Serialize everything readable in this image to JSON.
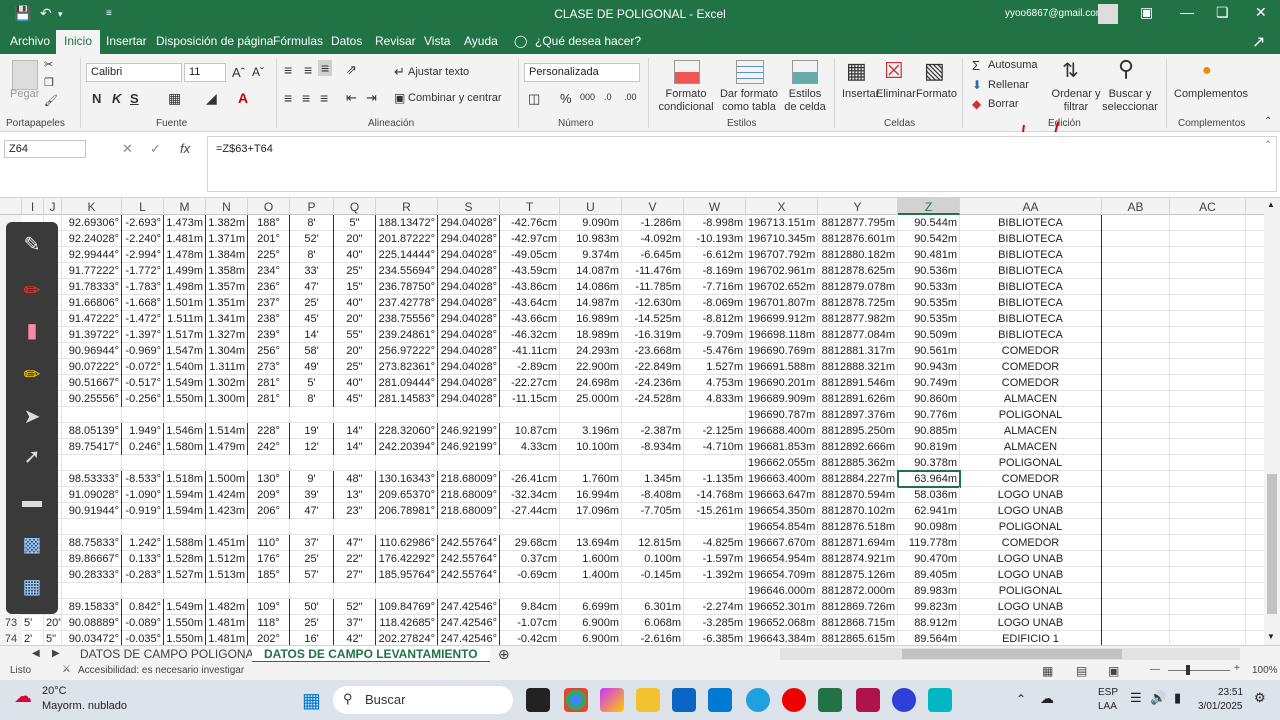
{
  "window": {
    "title": "CLASE DE POLIGONAL - Excel",
    "account": "yyoo6867@gmail.com"
  },
  "menu": [
    "Archivo",
    "Inicio",
    "Insertar",
    "Disposición de página",
    "Fórmulas",
    "Datos",
    "Revisar",
    "Vista",
    "Ayuda",
    "¿Qué desea hacer?"
  ],
  "ribbon": {
    "paste": "Pegar",
    "clipboard": "Portapapeles",
    "font_name": "Calibri",
    "font_size": "11",
    "font_group": "Fuente",
    "wrap": "Ajustar texto",
    "merge": "Combinar y centrar",
    "align_group": "Alineación",
    "number_format": "Personalizada",
    "number_group": "Número",
    "cond_format": "Formato condicional",
    "table_format": "Dar formato como tabla",
    "cell_styles": "Estilos de celda",
    "styles_group": "Estilos",
    "insert": "Insertar",
    "delete": "Eliminar",
    "format": "Formato",
    "cells_group": "Celdas",
    "autosum": "Autosuma",
    "fill": "Rellenar",
    "clear": "Borrar",
    "sort": "Ordenar y filtrar",
    "find": "Buscar y seleccionar",
    "edit_group": "Edición",
    "complements": "Complementos",
    "complements_group": "Complementos"
  },
  "formula_bar": {
    "namebox": "Z64",
    "formula": "=Z$63+T64"
  },
  "columns": [
    "I",
    "J",
    "K",
    "L",
    "M",
    "N",
    "O",
    "P",
    "Q",
    "R",
    "S",
    "T",
    "U",
    "V",
    "W",
    "X",
    "Y",
    "Z",
    "AA",
    "AB",
    "AC"
  ],
  "rows": [
    {
      "n": "",
      "k": "92.69306°",
      "l": "-2.693°",
      "m": "1.473m",
      "nn": "1.382m",
      "o": "188°",
      "p": "8'",
      "q": "5\"",
      "r": "188.13472°",
      "s": "294.04028°",
      "t": "-42.76cm",
      "u": "9.090m",
      "v": "-1.286m",
      "w": "-8.998m",
      "x": "196713.151m",
      "y": "8812877.795m",
      "z": "90.544m",
      "aa": "BIBLIOTECA"
    },
    {
      "n": "",
      "k": "92.24028°",
      "l": "-2.240°",
      "m": "1.481m",
      "nn": "1.371m",
      "o": "201°",
      "p": "52'",
      "q": "20\"",
      "r": "201.87222°",
      "s": "294.04028°",
      "t": "-42.97cm",
      "u": "10.983m",
      "v": "-4.092m",
      "w": "-10.193m",
      "x": "196710.345m",
      "y": "8812876.601m",
      "z": "90.542m",
      "aa": "BIBLIOTECA"
    },
    {
      "n": "",
      "k": "92.99444°",
      "l": "-2.994°",
      "m": "1.478m",
      "nn": "1.384m",
      "o": "225°",
      "p": "8'",
      "q": "40\"",
      "r": "225.14444°",
      "s": "294.04028°",
      "t": "-49.05cm",
      "u": "9.374m",
      "v": "-6.645m",
      "w": "-6.612m",
      "x": "196707.792m",
      "y": "8812880.182m",
      "z": "90.481m",
      "aa": "BIBLIOTECA"
    },
    {
      "n": "",
      "k": "91.77222°",
      "l": "-1.772°",
      "m": "1.499m",
      "nn": "1.358m",
      "o": "234°",
      "p": "33'",
      "q": "25\"",
      "r": "234.55694°",
      "s": "294.04028°",
      "t": "-43.59cm",
      "u": "14.087m",
      "v": "-11.476m",
      "w": "-8.169m",
      "x": "196702.961m",
      "y": "8812878.625m",
      "z": "90.536m",
      "aa": "BIBLIOTECA"
    },
    {
      "n": "",
      "k": "91.78333°",
      "l": "-1.783°",
      "m": "1.498m",
      "nn": "1.357m",
      "o": "236°",
      "p": "47'",
      "q": "15\"",
      "r": "236.78750°",
      "s": "294.04028°",
      "t": "-43.86cm",
      "u": "14.086m",
      "v": "-11.785m",
      "w": "-7.716m",
      "x": "196702.652m",
      "y": "8812879.078m",
      "z": "90.533m",
      "aa": "BIBLIOTECA"
    },
    {
      "n": "",
      "k": "91.66806°",
      "l": "-1.668°",
      "m": "1.501m",
      "nn": "1.351m",
      "o": "237°",
      "p": "25'",
      "q": "40\"",
      "r": "237.42778°",
      "s": "294.04028°",
      "t": "-43.64cm",
      "u": "14.987m",
      "v": "-12.630m",
      "w": "-8.069m",
      "x": "196701.807m",
      "y": "8812878.725m",
      "z": "90.535m",
      "aa": "BIBLIOTECA"
    },
    {
      "n": "",
      "k": "91.47222°",
      "l": "-1.472°",
      "m": "1.511m",
      "nn": "1.341m",
      "o": "238°",
      "p": "45'",
      "q": "20\"",
      "r": "238.75556°",
      "s": "294.04028°",
      "t": "-43.66cm",
      "u": "16.989m",
      "v": "-14.525m",
      "w": "-8.812m",
      "x": "196699.912m",
      "y": "8812877.982m",
      "z": "90.535m",
      "aa": "BIBLIOTECA"
    },
    {
      "n": "",
      "k": "91.39722°",
      "l": "-1.397°",
      "m": "1.517m",
      "nn": "1.327m",
      "o": "239°",
      "p": "14'",
      "q": "55\"",
      "r": "239.24861°",
      "s": "294.04028°",
      "t": "-46.32cm",
      "u": "18.989m",
      "v": "-16.319m",
      "w": "-9.709m",
      "x": "196698.118m",
      "y": "8812877.084m",
      "z": "90.509m",
      "aa": "BIBLIOTECA"
    },
    {
      "n": "",
      "k": "90.96944°",
      "l": "-0.969°",
      "m": "1.547m",
      "nn": "1.304m",
      "o": "256°",
      "p": "58'",
      "q": "20\"",
      "r": "256.97222°",
      "s": "294.04028°",
      "t": "-41.11cm",
      "u": "24.293m",
      "v": "-23.668m",
      "w": "-5.476m",
      "x": "196690.769m",
      "y": "8812881.317m",
      "z": "90.561m",
      "aa": "COMEDOR"
    },
    {
      "n": "",
      "k": "90.07222°",
      "l": "-0.072°",
      "m": "1.540m",
      "nn": "1.311m",
      "o": "273°",
      "p": "49'",
      "q": "25\"",
      "r": "273.82361°",
      "s": "294.04028°",
      "t": "-2.89cm",
      "u": "22.900m",
      "v": "-22.849m",
      "w": "1.527m",
      "x": "196691.588m",
      "y": "8812888.321m",
      "z": "90.943m",
      "aa": "COMEDOR"
    },
    {
      "n": "",
      "k": "90.51667°",
      "l": "-0.517°",
      "m": "1.549m",
      "nn": "1.302m",
      "o": "281°",
      "p": "5'",
      "q": "40\"",
      "r": "281.09444°",
      "s": "294.04028°",
      "t": "-22.27cm",
      "u": "24.698m",
      "v": "-24.236m",
      "w": "4.753m",
      "x": "196690.201m",
      "y": "8812891.546m",
      "z": "90.749m",
      "aa": "COMEDOR"
    },
    {
      "n": "",
      "k": "90.25556°",
      "l": "-0.256°",
      "m": "1.550m",
      "nn": "1.300m",
      "o": "281°",
      "p": "8'",
      "q": "45\"",
      "r": "281.14583°",
      "s": "294.04028°",
      "t": "-11.15cm",
      "u": "25.000m",
      "v": "-24.528m",
      "w": "4.833m",
      "x": "196689.909m",
      "y": "8812891.626m",
      "z": "90.860m",
      "aa": "ALMACEN"
    },
    {
      "n": "",
      "k": "",
      "l": "",
      "m": "",
      "nn": "",
      "o": "",
      "p": "",
      "q": "",
      "r": "",
      "s": "",
      "t": "",
      "u": "",
      "v": "",
      "w": "",
      "x": "196690.787m",
      "y": "8812897.376m",
      "z": "90.776m",
      "aa": "POLIGONAL"
    },
    {
      "n": "",
      "k": "88.05139°",
      "l": "1.949°",
      "m": "1.546m",
      "nn": "1.514m",
      "o": "228°",
      "p": "19'",
      "q": "14\"",
      "r": "228.32060°",
      "s": "246.92199°",
      "t": "10.87cm",
      "u": "3.196m",
      "v": "-2.387m",
      "w": "-2.125m",
      "x": "196688.400m",
      "y": "8812895.250m",
      "z": "90.885m",
      "aa": "ALMACEN"
    },
    {
      "n": "",
      "k": "89.75417°",
      "l": "0.246°",
      "m": "1.580m",
      "nn": "1.479m",
      "o": "242°",
      "p": "12'",
      "q": "14\"",
      "r": "242.20394°",
      "s": "246.92199°",
      "t": "4.33cm",
      "u": "10.100m",
      "v": "-8.934m",
      "w": "-4.710m",
      "x": "196681.853m",
      "y": "8812892.666m",
      "z": "90.819m",
      "aa": "ALMACEN"
    },
    {
      "n": "",
      "k": "",
      "l": "",
      "m": "",
      "nn": "",
      "o": "",
      "p": "",
      "q": "",
      "r": "",
      "s": "",
      "t": "",
      "u": "",
      "v": "",
      "w": "",
      "x": "196662.055m",
      "y": "8812885.362m",
      "z": "90.378m",
      "aa": "POLIGONAL"
    },
    {
      "n": "",
      "k": "98.53333°",
      "l": "-8.533°",
      "m": "1.518m",
      "nn": "1.500m",
      "o": "130°",
      "p": "9'",
      "q": "48\"",
      "r": "130.16343°",
      "s": "218.68009°",
      "t": "-26.41cm",
      "u": "1.760m",
      "v": "1.345m",
      "w": "-1.135m",
      "x": "196663.400m",
      "y": "8812884.227m",
      "z": "63.964m",
      "aa": "COMEDOR"
    },
    {
      "n": "",
      "k": "91.09028°",
      "l": "-1.090°",
      "m": "1.594m",
      "nn": "1.424m",
      "o": "209°",
      "p": "39'",
      "q": "13\"",
      "r": "209.65370°",
      "s": "218.68009°",
      "t": "-32.34cm",
      "u": "16.994m",
      "v": "-8.408m",
      "w": "-14.768m",
      "x": "196663.647m",
      "y": "8812870.594m",
      "z": "58.036m",
      "aa": "LOGO UNAB"
    },
    {
      "n": "",
      "k": "90.91944°",
      "l": "-0.919°",
      "m": "1.594m",
      "nn": "1.423m",
      "o": "206°",
      "p": "47'",
      "q": "23\"",
      "r": "206.78981°",
      "s": "218.68009°",
      "t": "-27.44cm",
      "u": "17.096m",
      "v": "-7.705m",
      "w": "-15.261m",
      "x": "196654.350m",
      "y": "8812870.102m",
      "z": "62.941m",
      "aa": "LOGO UNAB"
    },
    {
      "n": "",
      "k": "",
      "l": "",
      "m": "",
      "nn": "",
      "o": "",
      "p": "",
      "q": "",
      "r": "",
      "s": "",
      "t": "",
      "u": "",
      "v": "",
      "w": "",
      "x": "196654.854m",
      "y": "8812876.518m",
      "z": "90.098m",
      "aa": "POLIGONAL"
    },
    {
      "n": "",
      "k": "88.75833°",
      "l": "1.242°",
      "m": "1.588m",
      "nn": "1.451m",
      "o": "110°",
      "p": "37'",
      "q": "47\"",
      "r": "110.62986°",
      "s": "242.55764°",
      "t": "29.68cm",
      "u": "13.694m",
      "v": "12.815m",
      "w": "-4.825m",
      "x": "196667.670m",
      "y": "8812871.694m",
      "z": "119.778m",
      "aa": "COMEDOR"
    },
    {
      "n": "",
      "k": "89.86667°",
      "l": "0.133°",
      "m": "1.528m",
      "nn": "1.512m",
      "o": "176°",
      "p": "25'",
      "q": "22\"",
      "r": "176.42292°",
      "s": "242.55764°",
      "t": "0.37cm",
      "u": "1.600m",
      "v": "0.100m",
      "w": "-1.597m",
      "x": "196654.954m",
      "y": "8812874.921m",
      "z": "90.470m",
      "aa": "LOGO UNAB"
    },
    {
      "n": "",
      "k": "90.28333°",
      "l": "-0.283°",
      "m": "1.527m",
      "nn": "1.513m",
      "o": "185°",
      "p": "57'",
      "q": "27\"",
      "r": "185.95764°",
      "s": "242.55764°",
      "t": "-0.69cm",
      "u": "1.400m",
      "v": "-0.145m",
      "w": "-1.392m",
      "x": "196654.709m",
      "y": "8812875.126m",
      "z": "89.405m",
      "aa": "LOGO UNAB"
    },
    {
      "n": "",
      "k": "",
      "l": "",
      "m": "",
      "nn": "",
      "o": "",
      "p": "",
      "q": "",
      "r": "",
      "s": "",
      "t": "",
      "u": "",
      "v": "",
      "w": "",
      "x": "196646.000m",
      "y": "8812872.000m",
      "z": "89.983m",
      "aa": "POLIGONAL"
    },
    {
      "n": "",
      "k": "89.15833°",
      "l": "0.842°",
      "m": "1.549m",
      "nn": "1.482m",
      "o": "109°",
      "p": "50'",
      "q": "52\"",
      "r": "109.84769°",
      "s": "247.42546°",
      "t": "9.84cm",
      "u": "6.699m",
      "v": "6.301m",
      "w": "-2.274m",
      "x": "196652.301m",
      "y": "8812869.726m",
      "z": "99.823m",
      "aa": "LOGO UNAB"
    },
    {
      "n": "73",
      "k": "90.08889°",
      "l": "-0.089°",
      "m": "1.550m",
      "nn": "1.481m",
      "o": "118°",
      "p": "25'",
      "q": "37\"",
      "r": "118.42685°",
      "s": "247.42546°",
      "t": "-1.07cm",
      "u": "6.900m",
      "v": "6.068m",
      "w": "-3.285m",
      "x": "196652.068m",
      "y": "8812868.715m",
      "z": "88.912m",
      "aa": "LOGO UNAB",
      "i": "5'",
      "j": "20\""
    },
    {
      "n": "74",
      "k": "90.03472°",
      "l": "-0.035°",
      "m": "1.550m",
      "nn": "1.481m",
      "o": "202°",
      "p": "16'",
      "q": "42\"",
      "r": "202.27824°",
      "s": "247.42546°",
      "t": "-0.42cm",
      "u": "6.900m",
      "v": "-2.616m",
      "w": "-6.385m",
      "x": "196643.384m",
      "y": "8812865.615m",
      "z": "89.564m",
      "aa": "EDIFICIO 1",
      "i": "2'",
      "j": "5\""
    }
  ],
  "sheets": [
    "DATOS DE CAMPO POLIGONAL",
    "DATOS DE CAMPO LEVANTAMIENTO"
  ],
  "status": {
    "ready": "Listo",
    "accessibility": "Accesibilidad: es necesario investigar",
    "zoom": "100%"
  },
  "taskbar": {
    "weather_temp": "20°C",
    "weather_desc": "Mayorm. nublado",
    "search": "Buscar",
    "lang1": "ESP",
    "lang2": "LAA",
    "time": "23:51",
    "date": "3/01/2025"
  }
}
